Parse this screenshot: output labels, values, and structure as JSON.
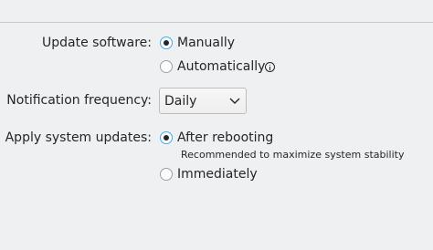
{
  "settings": {
    "update_software": {
      "label": "Update software:",
      "options": [
        {
          "label": "Manually",
          "checked": true
        },
        {
          "label": "Automatically",
          "checked": false,
          "has_info": true
        }
      ]
    },
    "notification_frequency": {
      "label": "Notification frequency:",
      "selected": "Daily"
    },
    "apply_updates": {
      "label": "Apply system updates:",
      "options": [
        {
          "label": "After rebooting",
          "checked": true,
          "hint": "Recommended to maximize system stability"
        },
        {
          "label": "Immediately",
          "checked": false
        }
      ]
    }
  },
  "icons": {
    "info": "info-icon",
    "dropdown": "chevron-down-icon"
  },
  "colors": {
    "accent": "#3daee9",
    "background": "#eff0f1",
    "text": "#232629"
  }
}
